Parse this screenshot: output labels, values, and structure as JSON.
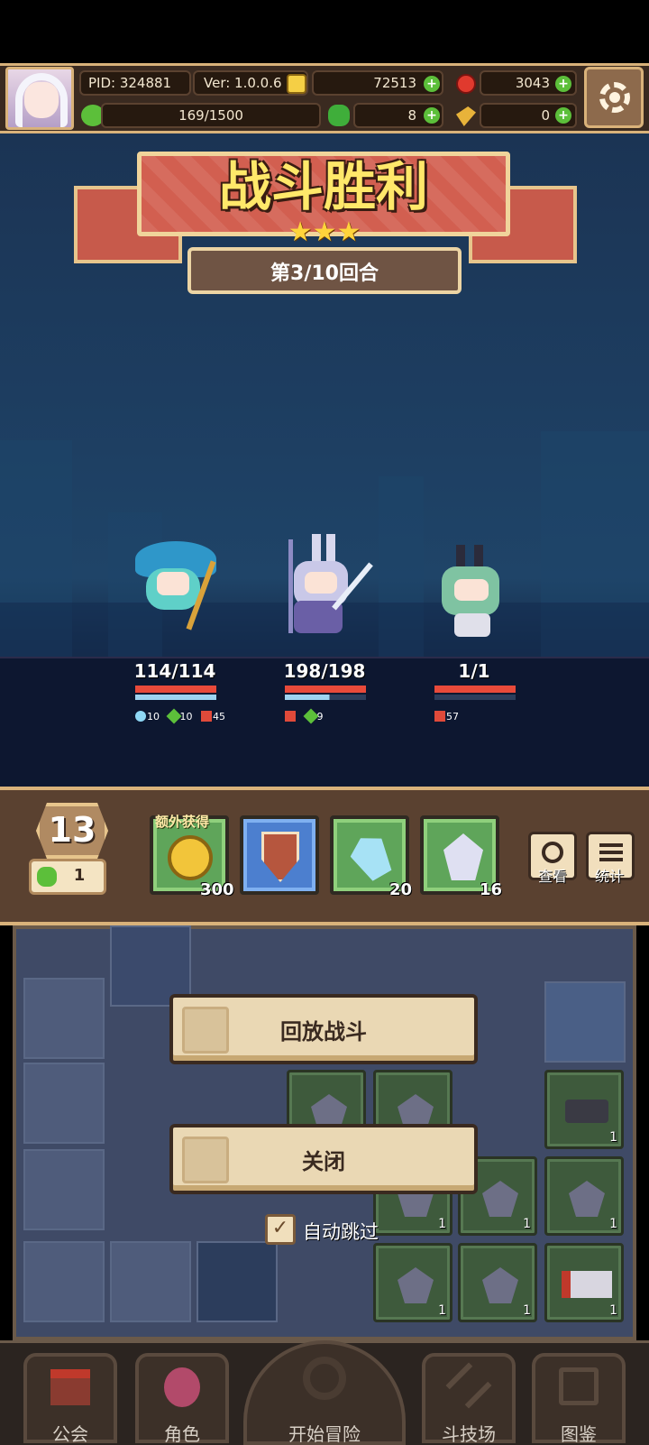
{
  "topbar": {
    "pid": "PID: 324881",
    "version": "Ver: 1.0.0.6",
    "gold": "72513",
    "gems": "3043",
    "stamina": "169/1500",
    "clover": "8",
    "tokens": "0"
  },
  "banner": {
    "title": "战斗胜利",
    "stars": 3,
    "round": "第3/10回合"
  },
  "heroes": [
    {
      "hp": "114/114",
      "buffs": [
        "10",
        "10",
        "45"
      ]
    },
    {
      "hp": "198/198",
      "buffs": [
        "",
        "9"
      ]
    },
    {
      "hp": "1/1",
      "buffs": [
        "57"
      ]
    }
  ],
  "rewards": {
    "level": "13",
    "clovers": "1",
    "extra_label": "额外获得",
    "items": [
      {
        "name": "gold-coin",
        "qty": "300"
      },
      {
        "name": "shield",
        "qty": ""
      },
      {
        "name": "blue-crystal",
        "qty": "20"
      },
      {
        "name": "white-crystal",
        "qty": "16"
      }
    ],
    "view_label": "查看",
    "stats_label": "统计"
  },
  "dialog": {
    "replay_label": "回放战斗",
    "close_label": "关闭",
    "auto_skip_label": "自动跳过",
    "auto_skip_checked": true
  },
  "board": {
    "item_count": "1"
  },
  "nav": {
    "guild": "公会",
    "character": "角色",
    "adventure": "开始冒险",
    "arena": "斗技场",
    "codex": "图鉴"
  }
}
